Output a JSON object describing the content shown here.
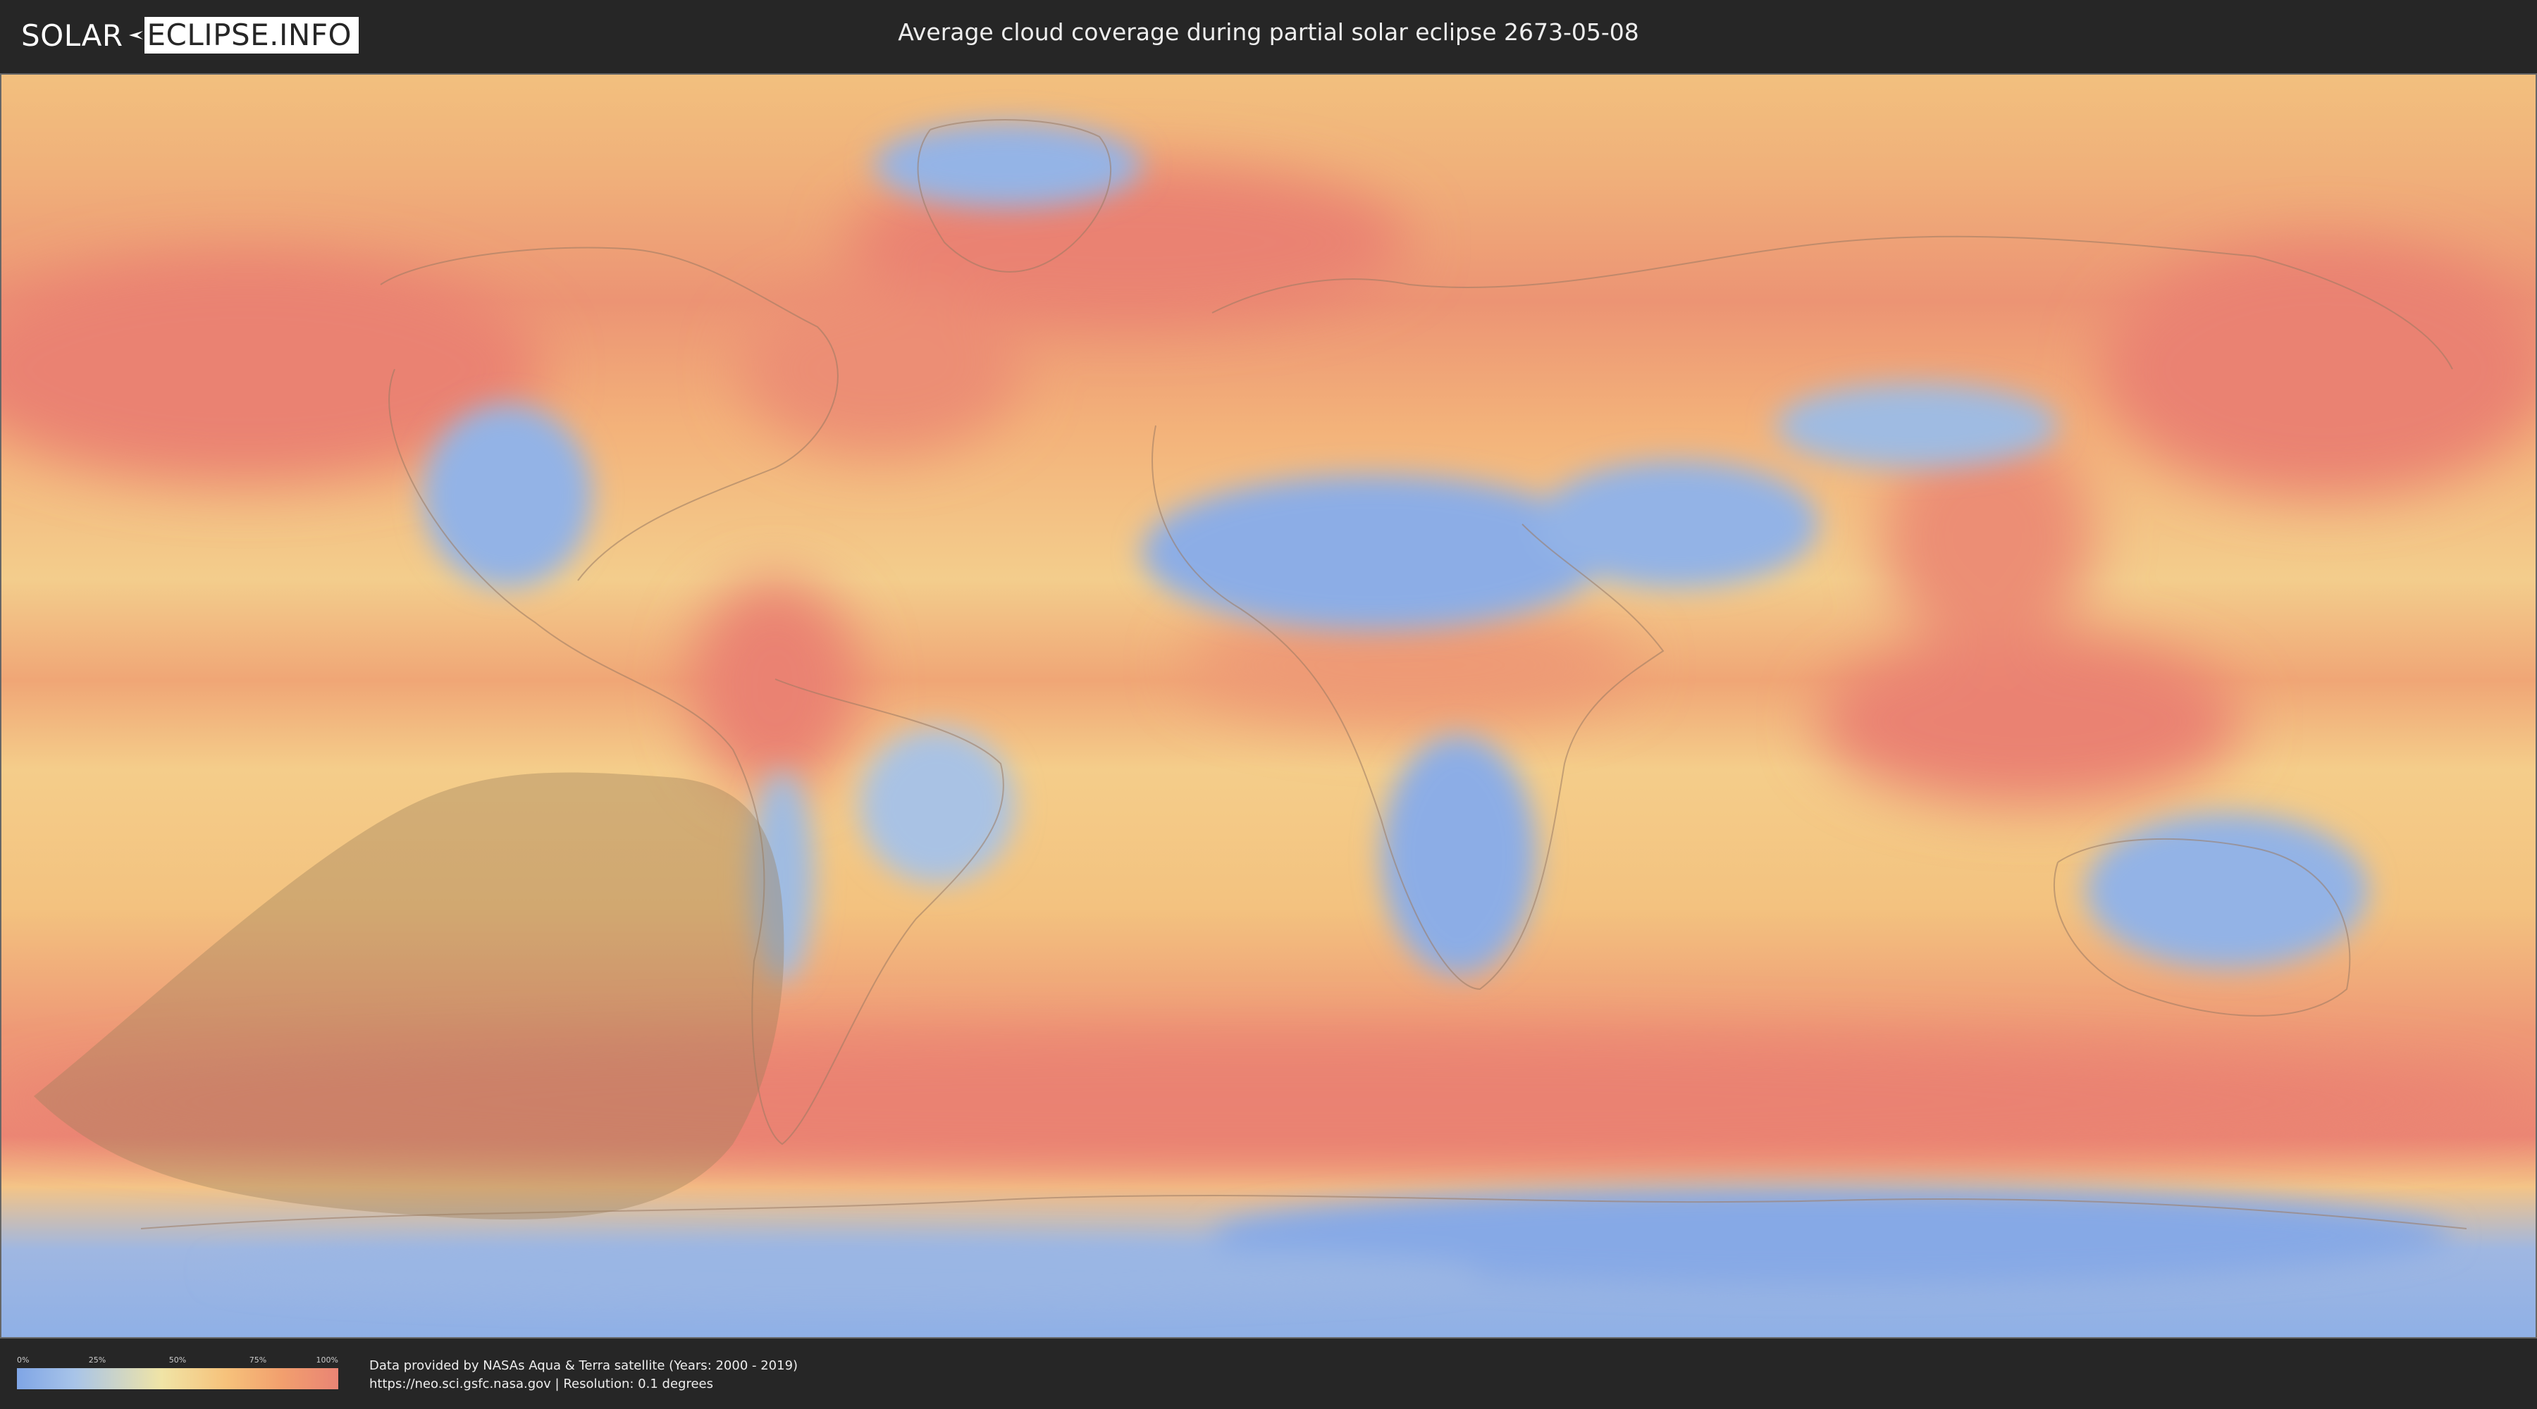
{
  "header": {
    "logo_part1": "SOLAR",
    "logo_part2": "ECLIPSE.INFO",
    "title": "Average cloud coverage during partial solar eclipse 2673-05-08"
  },
  "map": {
    "colors": {
      "ocean_cloudy": "#ee8a72",
      "mid_cloud": "#f5c27a",
      "low_cloud": "#f2dca0",
      "clear": "#8aaee6",
      "eclipse_shadow": "#9b7f5a"
    }
  },
  "legend": {
    "ticks": [
      "0%",
      "25%",
      "50%",
      "75%",
      "100%"
    ],
    "tick_values": [
      0,
      25,
      50,
      75,
      100
    ]
  },
  "credits": {
    "line1": "Data provided by NASAs Aqua & Terra satellite (Years: 2000 - 2019)",
    "line2": "https://neo.sci.gsfc.nasa.gov | Resolution: 0.1 degrees"
  }
}
